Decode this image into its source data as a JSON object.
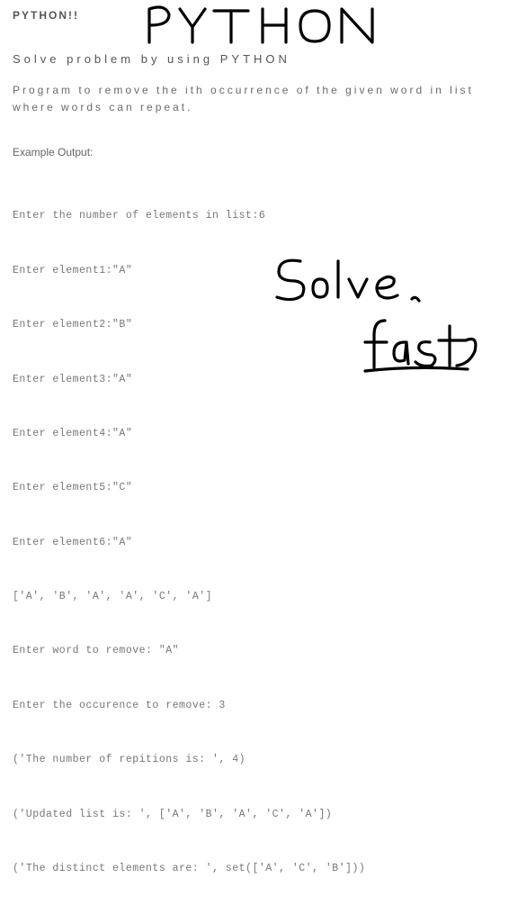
{
  "title_short": "PYTHON!!",
  "handwritten_title": "PYTHON",
  "heading": "Solve problem by using PYTHON",
  "description": "Program to remove the ith occurrence of the given word in list where words can repeat.",
  "example_label": "Example Output:",
  "output_lines": [
    "Enter the number of elements in list:6",
    "Enter element1:\"A\"",
    "Enter element2:\"B\"",
    "Enter element3:\"A\"",
    "Enter element4:\"A\"",
    "Enter element5:\"C\"",
    "Enter element6:\"A\"",
    "['A', 'B', 'A', 'A', 'C', 'A']",
    "Enter word to remove: \"A\"",
    "Enter the occurence to remove: 3",
    "('The number of repitions is: ', 4)",
    "('Updated list is: ', ['A', 'B', 'A', 'C', 'A'])",
    "('The distinct elements are: ', set(['A', 'C', 'B']))"
  ],
  "handwritten_solve": "Solve",
  "handwritten_fast": "fast"
}
